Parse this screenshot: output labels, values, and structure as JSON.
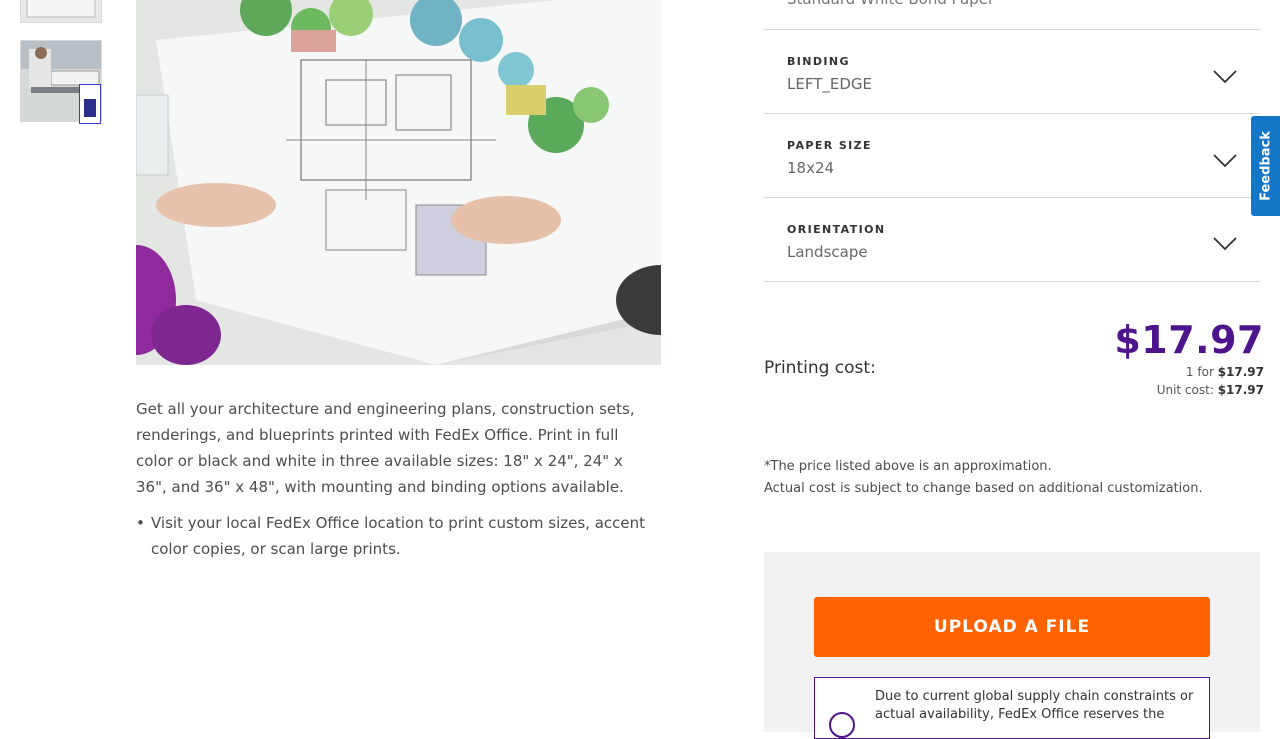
{
  "gallery": {
    "thumbnails": [
      "thumbnail-1",
      "thumbnail-2"
    ],
    "hero_alt": "Architectural blueprint print on table"
  },
  "description": {
    "paragraph": "Get all your architecture and engineering plans, construction sets, renderings, and blueprints printed with FedEx Office. Print in full color or black and white in three available sizes: 18\" x 24\", 24\" x 36\", and 36\" x 48\", with mounting and binding options available.",
    "bullets": [
      "Visit your local FedEx Office location to print custom sizes, accent color copies, or scan large prints."
    ]
  },
  "options": {
    "material_value": "Standard White Bond Paper",
    "binding": {
      "label": "BINDING",
      "value": "LEFT_EDGE"
    },
    "paper_size": {
      "label": "PAPER SIZE",
      "value": "18x24"
    },
    "orientation": {
      "label": "ORIENTATION",
      "value": "Landscape"
    }
  },
  "pricing": {
    "label": "Printing cost:",
    "total": "$17.97",
    "per_prefix": "1 for ",
    "per_value": "$17.97",
    "unit_prefix": "Unit cost: ",
    "unit_value": "$17.97",
    "disclaimer_1": "*The price listed above is an approximation.",
    "disclaimer_2": "Actual cost is subject to change based on additional customization."
  },
  "upload": {
    "button_label": "UPLOAD A FILE",
    "notice": "Due to current global supply chain constraints or actual availability, FedEx Office reserves the"
  },
  "feedback": {
    "label": "Feedback"
  },
  "colors": {
    "fedex_purple": "#4d148c",
    "fedex_orange": "#ff6200",
    "feedback_blue": "#1476c6"
  }
}
